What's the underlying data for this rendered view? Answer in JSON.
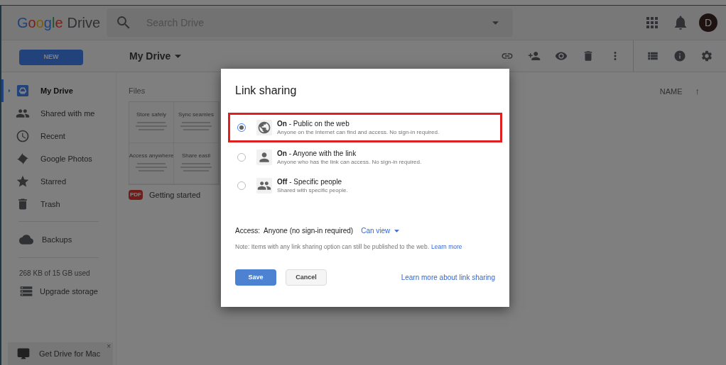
{
  "header": {
    "logo": [
      "G",
      "o",
      "o",
      "g",
      "l",
      "e"
    ],
    "product": "Drive",
    "search": {
      "placeholder": "Search Drive"
    },
    "avatar": "D"
  },
  "toolbar": {
    "new_button": "NEW",
    "location": "My Drive"
  },
  "sidebar": {
    "items": [
      {
        "label": "My Drive",
        "selected": true
      },
      {
        "label": "Shared with me",
        "selected": false
      },
      {
        "label": "Recent",
        "selected": false
      },
      {
        "label": "Google Photos",
        "selected": false
      },
      {
        "label": "Starred",
        "selected": false
      },
      {
        "label": "Trash",
        "selected": false
      }
    ],
    "backups": "Backups",
    "storage": "268 KB of 15 GB used",
    "upgrade": "Upgrade storage",
    "promo": "Get Drive for Mac",
    "promo_close": "×"
  },
  "files": {
    "heading": "Files",
    "sort_column": "NAME",
    "sort_arrow": "↑",
    "preview_cards": [
      {
        "title": "Store safely"
      },
      {
        "title": "Sync seamles"
      },
      {
        "title": "Access anywhere"
      },
      {
        "title": "Share easil"
      }
    ],
    "file": {
      "badge": "PDF",
      "name": "Getting started"
    }
  },
  "dialog": {
    "title": "Link sharing",
    "options": [
      {
        "label": "**On** - Public on the web",
        "description": "Anyone on the Internet can find and access. No sign-in required.",
        "selected": true,
        "highlighted": true
      },
      {
        "label": "**On** - Anyone with the link",
        "description": "Anyone who has the link can access. No sign-in required.",
        "selected": false,
        "highlighted": false
      },
      {
        "label": "**Off** - Specific people",
        "description": "Shared with specific people.",
        "selected": false,
        "highlighted": false
      }
    ],
    "access": {
      "label": "Access:",
      "value": "Anyone (no sign-in required)",
      "dropdown": "Can view"
    },
    "note": "Note: Items with any link sharing option can still be published to the web.",
    "note_link": "Learn more",
    "save": "Save",
    "cancel": "Cancel",
    "help_link": "Learn more about link sharing"
  }
}
